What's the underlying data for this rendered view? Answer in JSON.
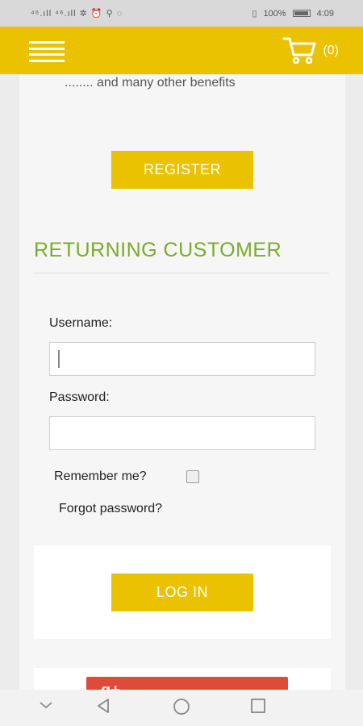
{
  "status_bar": {
    "left_icons": "⁴⁶.ıll ⁴⁶.ıll ✲ ⏰ ⚲ ◌",
    "battery": "100%",
    "time": "4:09"
  },
  "app_bar": {
    "menu_icon": "hamburger-icon",
    "cart_icon": "shopping-cart-icon",
    "cart_count": "(0)"
  },
  "register_section": {
    "benefits_text": "........ and many other benefits",
    "register_label": "REGISTER"
  },
  "returning_customer": {
    "title": "RETURNING CUSTOMER",
    "username_label": "Username:",
    "username_value": "",
    "password_label": "Password:",
    "password_value": "",
    "remember_label": "Remember me?",
    "remember_checked": false,
    "forgot_label": "Forgot password?",
    "login_label": "LOG IN"
  },
  "social_login": {
    "icon": "google-plus-icon",
    "glyph": "g+"
  },
  "nav_bar": {
    "icons": [
      "chevron-down-icon",
      "back-icon",
      "home-icon",
      "recents-icon"
    ]
  },
  "colors": {
    "accent": "#ebc200",
    "title_green": "#7aab2c",
    "social_red": "#df4b3b"
  }
}
